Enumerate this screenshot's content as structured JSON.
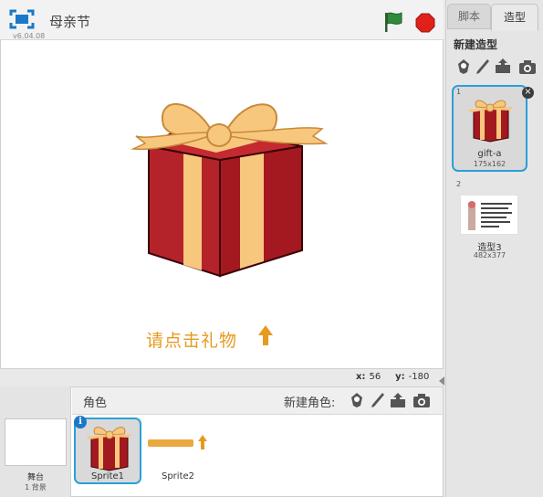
{
  "stage": {
    "title": "母亲节",
    "version": "v6.04.08",
    "hint_text": "请点击礼物",
    "coords": {
      "x_label": "x:",
      "x_value": "56",
      "y_label": "y:",
      "y_value": "-180"
    }
  },
  "sprites_panel": {
    "stage_label": "舞台",
    "backdrop_count": "1 背景",
    "header_label": "角色",
    "new_sprite_label": "新建角色:",
    "sprites": [
      {
        "name": "Sprite1",
        "selected": true
      },
      {
        "name": "Sprite2",
        "selected": false
      }
    ]
  },
  "right_panel": {
    "tabs": [
      {
        "label": "脚本"
      },
      {
        "label": "造型"
      }
    ],
    "active_tab": "造型",
    "new_costume_label": "新建造型",
    "costumes": [
      {
        "index": "1",
        "name": "gift-a",
        "size": "175x162",
        "selected": true
      },
      {
        "index": "2",
        "name": "造型3",
        "size": "482x377",
        "selected": false
      }
    ]
  },
  "colors": {
    "accent_blue": "#2aa0d8",
    "gift_red": "#a3191f",
    "ribbon_peach": "#f8c77e",
    "hint_orange": "#e69a1e",
    "flag_green": "#2e8b3a",
    "stop_red": "#e0211a"
  },
  "icons": [
    "fullscreen-icon",
    "green-flag-icon",
    "stop-icon",
    "choose-from-library-icon",
    "paint-icon",
    "upload-icon",
    "camera-icon",
    "info-icon",
    "delete-icon",
    "up-arrow-icon"
  ]
}
